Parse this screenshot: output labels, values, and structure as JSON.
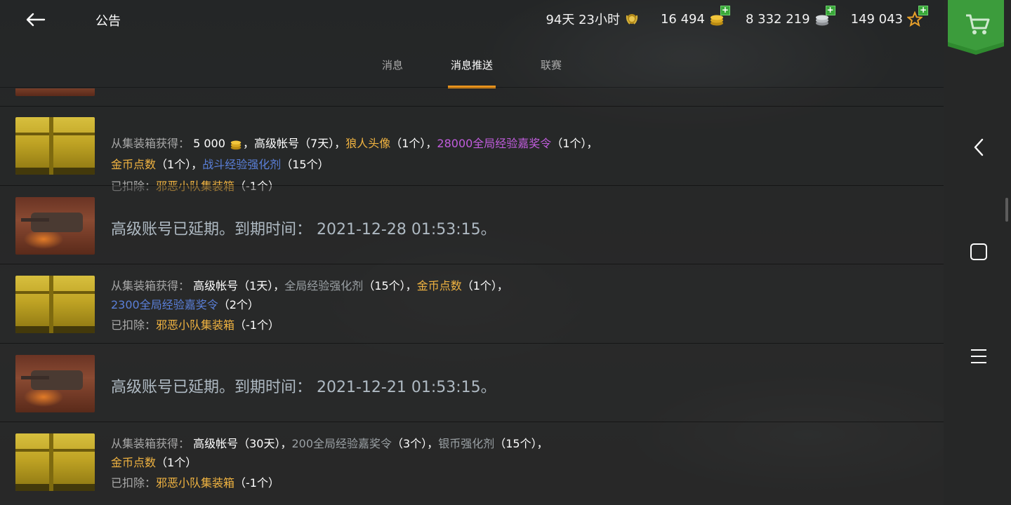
{
  "header": {
    "title": "公告",
    "premium_time": "94天 23小时",
    "gold": "16 494",
    "silver": "8 332 219",
    "free_xp": "149 043"
  },
  "tabs": [
    {
      "label": "消息",
      "active": false
    },
    {
      "label": "消息推送",
      "active": true
    },
    {
      "label": "联赛",
      "active": false
    }
  ],
  "messages": [
    {
      "type": "crate",
      "line1_prefix": "从集装箱获得：",
      "line1_items": [
        {
          "text": "5 000",
          "color": "white"
        },
        {
          "text": "，高级帐号（7天），",
          "color": "white"
        },
        {
          "text": "狼人头像",
          "color": "orange"
        },
        {
          "text": "（1个），",
          "color": "white"
        },
        {
          "text": "28000全局经验嘉奖令",
          "color": "purple"
        },
        {
          "text": "（1个），",
          "color": "white"
        }
      ],
      "line2_items": [
        {
          "text": "金币点数",
          "color": "orange"
        },
        {
          "text": "（1个），",
          "color": "white"
        },
        {
          "text": "战斗经验强化剂",
          "color": "blue"
        },
        {
          "text": "（15个）",
          "color": "white"
        }
      ],
      "deducted_label": "已扣除：",
      "deducted_item": "邪恶小队集装箱",
      "deducted_count": "（-1个）"
    },
    {
      "type": "tank",
      "text": "高级账号已延期。到期时间：  2021-12-28 01:53:15。"
    },
    {
      "type": "crate",
      "line1_prefix": "从集装箱获得：",
      "line1_items": [
        {
          "text": "高级帐号（1天），",
          "color": "white"
        },
        {
          "text": "全局经验强化剂",
          "color": "gray"
        },
        {
          "text": "（15个），",
          "color": "white"
        },
        {
          "text": "金币点数",
          "color": "orange"
        },
        {
          "text": "（1个），",
          "color": "white"
        }
      ],
      "line2_items": [
        {
          "text": "2300全局经验嘉奖令",
          "color": "blue"
        },
        {
          "text": "（2个）",
          "color": "white"
        }
      ],
      "deducted_label": "已扣除：",
      "deducted_item": "邪恶小队集装箱",
      "deducted_count": "（-1个）"
    },
    {
      "type": "tank",
      "text": "高级账号已延期。到期时间：  2021-12-21 01:53:15。"
    },
    {
      "type": "crate",
      "line1_prefix": "从集装箱获得：",
      "line1_items": [
        {
          "text": "高级帐号（30天），",
          "color": "white"
        },
        {
          "text": "200全局经验嘉奖令",
          "color": "gray"
        },
        {
          "text": "（3个），",
          "color": "white"
        },
        {
          "text": "银币强化剂",
          "color": "gray"
        },
        {
          "text": "（15个），",
          "color": "white"
        }
      ],
      "line2_items": [
        {
          "text": "金币点数",
          "color": "orange"
        },
        {
          "text": "（1个）",
          "color": "white"
        }
      ],
      "deducted_label": "已扣除：",
      "deducted_item": "邪恶小队集装箱",
      "deducted_count": "（-1个）"
    }
  ],
  "icons": {
    "back": "arrow-left-icon",
    "premium": "premium-laurel-icon",
    "gold": "gold-coins-icon",
    "silver": "silver-coins-icon",
    "free_xp": "star-icon",
    "shop": "cart-icon",
    "nav_back": "chevron-left-icon",
    "nav_home": "square-icon",
    "nav_menu": "menu-icon"
  },
  "colors": {
    "accent": "#f39a1e",
    "orange_item": "#f0b341",
    "purple_item": "#c15ddd",
    "blue_item": "#5a7fd8",
    "shop_green": "#2f8a2f"
  }
}
